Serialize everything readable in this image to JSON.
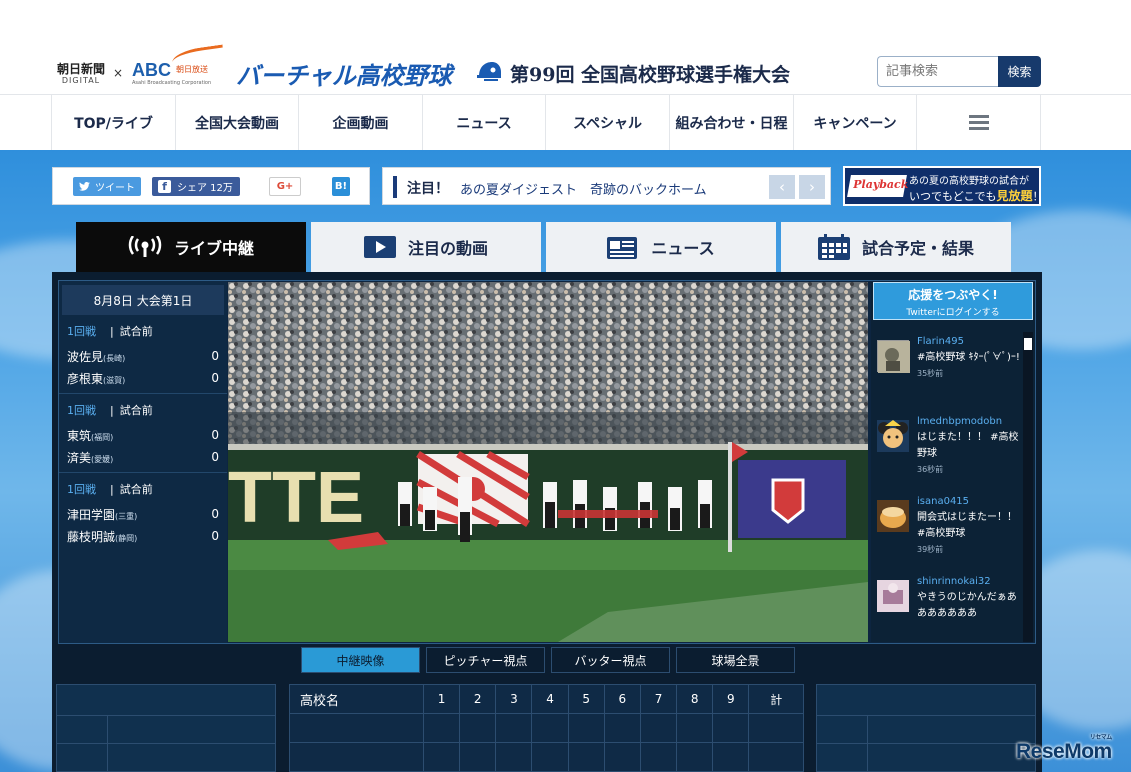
{
  "header": {
    "asahi_l1": "朝日新聞",
    "asahi_l2": "DIGITAL",
    "times": "×",
    "abc": "ABC",
    "abc_jp": "朝日放送",
    "abc_en": "Asahi Broadcasting Corporation",
    "site_logo": "バーチャル高校野球",
    "tournament_title": "第99回 全国高校野球選手権大会",
    "search_placeholder": "記事検索",
    "search_button": "検索"
  },
  "nav": {
    "items": [
      "TOP/ライブ",
      "全国大会動画",
      "企画動画",
      "ニュース",
      "スペシャル",
      "組み合わせ・日程",
      "キャンペーン"
    ]
  },
  "share": {
    "tweet": "ツイート",
    "facebook": "シェア 12万",
    "gplus": "G+",
    "hatena": "B!"
  },
  "notice": {
    "label": "注目！",
    "text": "あの夏ダイジェスト　奇跡のバックホーム",
    "prev": "‹",
    "next": "›"
  },
  "playback": {
    "logo": "Playback",
    "line1": "あの夏の高校野球の試合が",
    "line2_pre": "いつでもどこでも",
    "line2_em": "見放題",
    "line2_post": "！"
  },
  "tabs": [
    {
      "label": "ライブ中継",
      "icon": "broadcast-icon"
    },
    {
      "label": "注目の動画",
      "icon": "play-icon"
    },
    {
      "label": "ニュース",
      "icon": "newspaper-icon"
    },
    {
      "label": "試合予定・結果",
      "icon": "calendar-icon"
    }
  ],
  "schedule": {
    "date": "8月8日 大会第1日",
    "matches": [
      {
        "round": "1回戦",
        "status": "試合前",
        "teams": [
          {
            "name": "波佐見",
            "pref": "(長崎)",
            "score": "0"
          },
          {
            "name": "彦根東",
            "pref": "(滋賀)",
            "score": "0"
          }
        ]
      },
      {
        "round": "1回戦",
        "status": "試合前",
        "teams": [
          {
            "name": "東筑",
            "pref": "(福岡)",
            "score": "0"
          },
          {
            "name": "済美",
            "pref": "(愛媛)",
            "score": "0"
          }
        ]
      },
      {
        "round": "1回戦",
        "status": "試合前",
        "teams": [
          {
            "name": "津田学園",
            "pref": "(三重)",
            "score": "0"
          },
          {
            "name": "藤枝明誠",
            "pref": "(静岡)",
            "score": "0"
          }
        ]
      }
    ]
  },
  "video": {
    "ad_text": "TTE"
  },
  "twitter": {
    "head1": "応援をつぶやく!",
    "head2": "Twitterにログインする",
    "tweets": [
      {
        "user": "Flarin495",
        "body": "#高校野球 ｷﾀｰ(ﾟ∀ﾟ)ｰ!",
        "time": "35秒前"
      },
      {
        "user": "lmednbpmodobn",
        "body": "はじまた！！！ #高校野球",
        "time": "36秒前"
      },
      {
        "user": "isana0415",
        "body": "開会式はじまたー！！ #高校野球",
        "time": "39秒前"
      },
      {
        "user": "shinrinnokai32",
        "body": "やきうのじかんだぁあああああああ",
        "time": ""
      }
    ]
  },
  "view_tabs": [
    "中継映像",
    "ピッチャー視点",
    "バッター視点",
    "球場全景"
  ],
  "scoreboard": {
    "school_header": "高校名",
    "innings": [
      "1",
      "2",
      "3",
      "4",
      "5",
      "6",
      "7",
      "8",
      "9",
      "計"
    ]
  },
  "watermark": {
    "text": "ReseMom",
    "small": "リセマム"
  },
  "colors": {
    "brand_blue": "#1a5bb2",
    "navy": "#1b2a4a",
    "panel_dark": "#0b1d30",
    "accent_cyan": "#2a9ad6",
    "orange": "#e96b1f"
  }
}
